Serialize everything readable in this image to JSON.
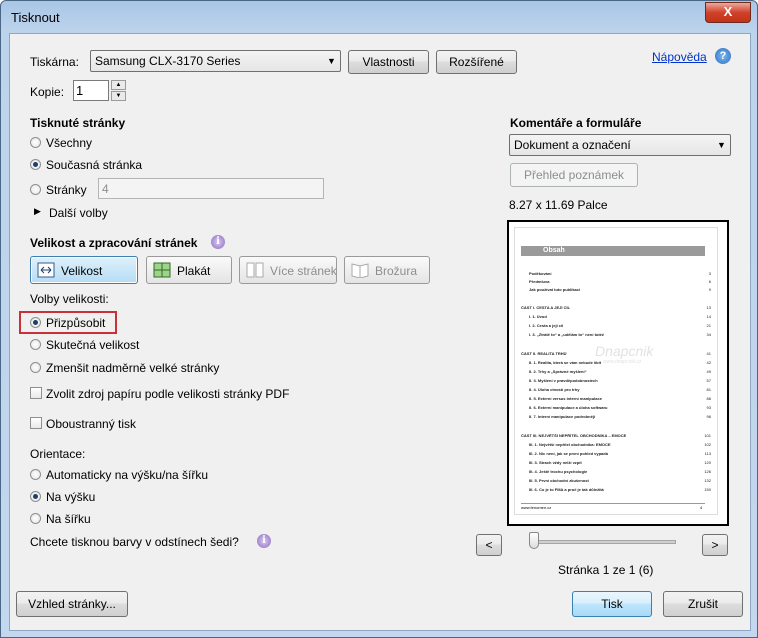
{
  "window": {
    "title": "Tisknout",
    "close_label": "X"
  },
  "printer": {
    "label": "Tiskárna:",
    "selected": "Samsung CLX-3170 Series",
    "properties_btn": "Vlastnosti",
    "advanced_btn": "Rozšířené",
    "help_link": "Nápověda"
  },
  "copies": {
    "label": "Kopie:",
    "value": "1"
  },
  "pages": {
    "heading": "Tisknuté stránky",
    "all": "Všechny",
    "current": "Současná stránka",
    "range": "Stránky",
    "range_value": "4",
    "more": "Další volby"
  },
  "sizing": {
    "heading": "Velikost a zpracování stránek",
    "btn_size": "Velikost",
    "btn_poster": "Plakát",
    "btn_multiple": "Více stránek",
    "btn_booklet": "Brožura",
    "options_label": "Volby velikosti:",
    "fit": "Přizpůsobit",
    "actual": "Skutečná velikost",
    "shrink": "Zmenšit nadměrně velké stránky",
    "paper_source": "Zvolit zdroj papíru podle velikosti stránky PDF",
    "duplex": "Oboustranný tisk"
  },
  "orientation": {
    "label": "Orientace:",
    "auto": "Automaticky na výšku/na šířku",
    "portrait": "Na výšku",
    "landscape": "Na šířku"
  },
  "grayscale": {
    "question": "Chcete tisknou barvy v odstínech šedi?"
  },
  "comments": {
    "heading": "Komentáře a formuláře",
    "selected": "Dokument a označení",
    "summary_btn": "Přehled poznámek"
  },
  "preview": {
    "size_text": "8.27 x 11.69 Palce",
    "doc_heading": "Obsah",
    "watermark": "Dnapcnik",
    "watermark_sub": "www.dnapcnik.cz",
    "footer_left": "www.fenomen.cz",
    "footer_right": "4",
    "toc": [
      {
        "text": "Poděkování",
        "page": "3"
      },
      {
        "text": "Předmluva",
        "page": "6"
      },
      {
        "text": "Jak používat tuto publikaci",
        "page": "9"
      },
      {
        "text": "ČÁST I. CESTA A JEJÍ CÍL",
        "page": "13"
      },
      {
        "text": "I. 1. Úvod",
        "page": "14"
      },
      {
        "text": "I. 2. Cesta a její cíl",
        "page": "21"
      },
      {
        "text": "I. 3. „Ztrátě to“ a „udělám to“ není totéž",
        "page": "34"
      },
      {
        "text": "ČÁST II. REALITA TRHŮ",
        "page": "41"
      },
      {
        "text": "II. 1. Realita, která se vám nebude líbit",
        "page": "42"
      },
      {
        "text": "II. 2. Trhy a „Správné myšlení“",
        "page": "49"
      },
      {
        "text": "II. 3. Myšlení v pravděpodobnostech",
        "page": "57"
      },
      {
        "text": "II. 4. Úloha ctností pro trhy",
        "page": "81"
      },
      {
        "text": "II. 5. Externí versus interní manipulace",
        "page": "88"
      },
      {
        "text": "II. 6. Externí manipulace a úloha softwaru",
        "page": "93"
      },
      {
        "text": "II. 7. Interní manipulace podrobněji",
        "page": "96"
      },
      {
        "text": "ČÁST III. NEJVĚTŠÍ NEPŘÍTEL OBCHODNÍKA – EMOCE",
        "page": "101"
      },
      {
        "text": "III. 1. Největší nepřítel obchodníka: EMOCE",
        "page": "102"
      },
      {
        "text": "III. 2. Nic není, jak se první pohled vypadá",
        "page": "113"
      },
      {
        "text": "III. 3. Strach vždy nelží vzpít",
        "page": "120"
      },
      {
        "text": "III. 4. Ještě trochu psychologie",
        "page": "126"
      },
      {
        "text": "III. 5. První obchodní zkušenost",
        "page": "132"
      },
      {
        "text": "III. 6. Co je to FMA a proč je tak důležitá",
        "page": "150"
      }
    ]
  },
  "navigation": {
    "prev": "<",
    "next": ">",
    "page_status": "Stránka 1 ze 1 (6)"
  },
  "footer": {
    "page_setup_btn": "Vzhled stránky...",
    "print_btn": "Tisk",
    "cancel_btn": "Zrušit"
  },
  "colors": {
    "highlight_box": "#c8313a",
    "link": "#0033cc",
    "doc_heading_bg": "#9a9a9a"
  }
}
